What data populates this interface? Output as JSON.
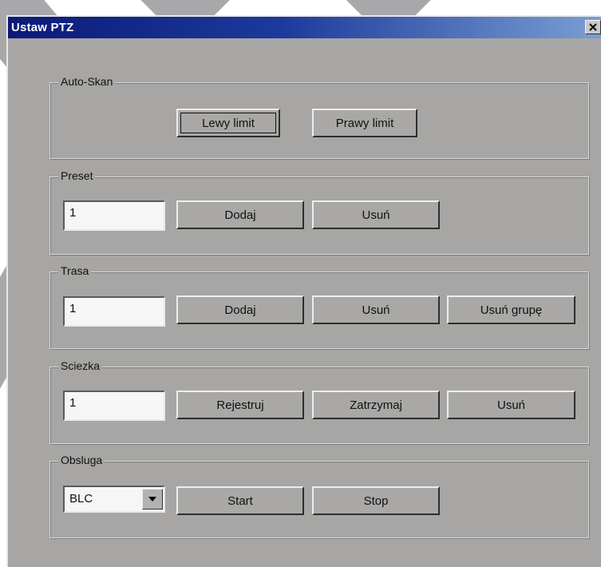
{
  "window": {
    "title": "Ustaw PTZ",
    "close_icon": "close-icon"
  },
  "colors": {
    "dialog_background": "#a7a6a4",
    "titlebar_start": "#0b1a78",
    "titlebar_end": "#7fa2d6",
    "field_background": "#f6f6f6"
  },
  "groups": {
    "autoscan": {
      "label": "Auto-Skan",
      "left_limit": "Lewy limit",
      "right_limit": "Prawy limit"
    },
    "preset": {
      "label": "Preset",
      "value": "1",
      "add": "Dodaj",
      "remove": "Usuń"
    },
    "route": {
      "label": "Trasa",
      "value": "1",
      "add": "Dodaj",
      "remove": "Usuń",
      "remove_group": "Usuń grupę"
    },
    "path": {
      "label": "Sciezka",
      "value": "1",
      "record": "Rejestruj",
      "stop": "Zatrzymaj",
      "remove": "Usuń"
    },
    "service": {
      "label": "Obsluga",
      "selected": "BLC",
      "start": "Start",
      "stop": "Stop"
    }
  }
}
